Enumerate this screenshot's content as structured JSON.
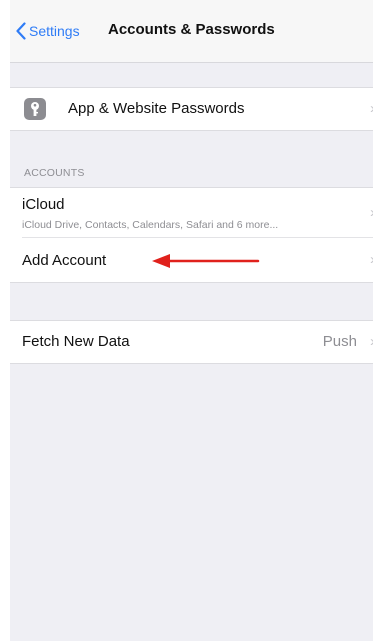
{
  "navbar": {
    "back_label": "Settings",
    "title": "Accounts & Passwords"
  },
  "passwords_row": {
    "label": "App & Website Passwords",
    "icon": "key-icon"
  },
  "accounts_section": {
    "header": "ACCOUNTS",
    "items": [
      {
        "label": "iCloud",
        "subtitle": "iCloud Drive, Contacts, Calendars, Safari and 6 more..."
      },
      {
        "label": "Add Account"
      }
    ]
  },
  "fetch_row": {
    "label": "Fetch New Data",
    "value": "Push"
  },
  "colors": {
    "accent": "#2f7cf6",
    "annotation_arrow": "#e0211c",
    "background": "#efeff4"
  }
}
